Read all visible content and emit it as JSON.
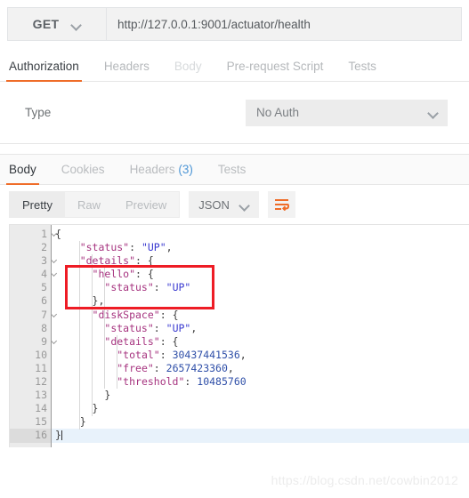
{
  "request": {
    "method": "GET",
    "method_chevron_icon": "chevron-down-icon",
    "url": "http://127.0.0.1:9001/actuator/health"
  },
  "request_tabs": [
    {
      "label": "Authorization",
      "active": true
    },
    {
      "label": "Headers",
      "active": false
    },
    {
      "label": "Body",
      "active": false
    },
    {
      "label": "Pre-request Script",
      "active": false
    },
    {
      "label": "Tests",
      "active": false
    }
  ],
  "auth": {
    "type_label": "Type",
    "selected": "No Auth",
    "chevron_icon": "chevron-down-icon"
  },
  "response_tabs": [
    {
      "label": "Body",
      "count": "",
      "active": true
    },
    {
      "label": "Cookies",
      "count": "",
      "active": false
    },
    {
      "label": "Headers",
      "count": "(3)",
      "active": false
    },
    {
      "label": "Tests",
      "count": "",
      "active": false
    }
  ],
  "body_toolbar": {
    "view_modes": [
      {
        "label": "Pretty",
        "active": true
      },
      {
        "label": "Raw",
        "active": false
      },
      {
        "label": "Preview",
        "active": false
      }
    ],
    "format": "JSON",
    "format_chevron_icon": "chevron-down-icon",
    "wrap_icon": "word-wrap-icon"
  },
  "editor": {
    "active_line": 16,
    "fold_lines": [
      1,
      3,
      4,
      7,
      9
    ],
    "lines": [
      {
        "n": 1,
        "tokens": [
          {
            "t": "{",
            "c": "p"
          }
        ]
      },
      {
        "n": 2,
        "tokens": [
          {
            "t": "    ",
            "c": "p"
          },
          {
            "t": "\"status\"",
            "c": "k"
          },
          {
            "t": ": ",
            "c": "p"
          },
          {
            "t": "\"UP\"",
            "c": "s"
          },
          {
            "t": ",",
            "c": "p"
          }
        ]
      },
      {
        "n": 3,
        "tokens": [
          {
            "t": "    ",
            "c": "p"
          },
          {
            "t": "\"details\"",
            "c": "k"
          },
          {
            "t": ": {",
            "c": "p"
          }
        ]
      },
      {
        "n": 4,
        "tokens": [
          {
            "t": "      ",
            "c": "p"
          },
          {
            "t": "\"hello\"",
            "c": "k"
          },
          {
            "t": ": {",
            "c": "p"
          }
        ]
      },
      {
        "n": 5,
        "tokens": [
          {
            "t": "        ",
            "c": "p"
          },
          {
            "t": "\"status\"",
            "c": "k"
          },
          {
            "t": ": ",
            "c": "p"
          },
          {
            "t": "\"UP\"",
            "c": "s"
          }
        ]
      },
      {
        "n": 6,
        "tokens": [
          {
            "t": "      },",
            "c": "p"
          }
        ]
      },
      {
        "n": 7,
        "tokens": [
          {
            "t": "      ",
            "c": "p"
          },
          {
            "t": "\"diskSpace\"",
            "c": "k"
          },
          {
            "t": ": {",
            "c": "p"
          }
        ]
      },
      {
        "n": 8,
        "tokens": [
          {
            "t": "        ",
            "c": "p"
          },
          {
            "t": "\"status\"",
            "c": "k"
          },
          {
            "t": ": ",
            "c": "p"
          },
          {
            "t": "\"UP\"",
            "c": "s"
          },
          {
            "t": ",",
            "c": "p"
          }
        ]
      },
      {
        "n": 9,
        "tokens": [
          {
            "t": "        ",
            "c": "p"
          },
          {
            "t": "\"details\"",
            "c": "k"
          },
          {
            "t": ": {",
            "c": "p"
          }
        ]
      },
      {
        "n": 10,
        "tokens": [
          {
            "t": "          ",
            "c": "p"
          },
          {
            "t": "\"total\"",
            "c": "k"
          },
          {
            "t": ": ",
            "c": "p"
          },
          {
            "t": "30437441536",
            "c": "n"
          },
          {
            "t": ",",
            "c": "p"
          }
        ]
      },
      {
        "n": 11,
        "tokens": [
          {
            "t": "          ",
            "c": "p"
          },
          {
            "t": "\"free\"",
            "c": "k"
          },
          {
            "t": ": ",
            "c": "p"
          },
          {
            "t": "2657423360",
            "c": "n"
          },
          {
            "t": ",",
            "c": "p"
          }
        ]
      },
      {
        "n": 12,
        "tokens": [
          {
            "t": "          ",
            "c": "p"
          },
          {
            "t": "\"threshold\"",
            "c": "k"
          },
          {
            "t": ": ",
            "c": "p"
          },
          {
            "t": "10485760",
            "c": "n"
          }
        ]
      },
      {
        "n": 13,
        "tokens": [
          {
            "t": "        }",
            "c": "p"
          }
        ]
      },
      {
        "n": 14,
        "tokens": [
          {
            "t": "      }",
            "c": "p"
          }
        ]
      },
      {
        "n": 15,
        "tokens": [
          {
            "t": "    }",
            "c": "p"
          }
        ]
      },
      {
        "n": 16,
        "tokens": [
          {
            "t": "}",
            "c": "p"
          }
        ]
      }
    ]
  },
  "annotation": {
    "redbox_color": "#ee1c25",
    "covers_lines": "4-6"
  },
  "watermark": "https://blog.csdn.net/cowbin2012",
  "colors": {
    "accent": "#ef6c28",
    "link": "#4d96d6",
    "json_key": "#a6337f",
    "json_string": "#3a3ad0",
    "json_number": "#2f4fa8"
  }
}
